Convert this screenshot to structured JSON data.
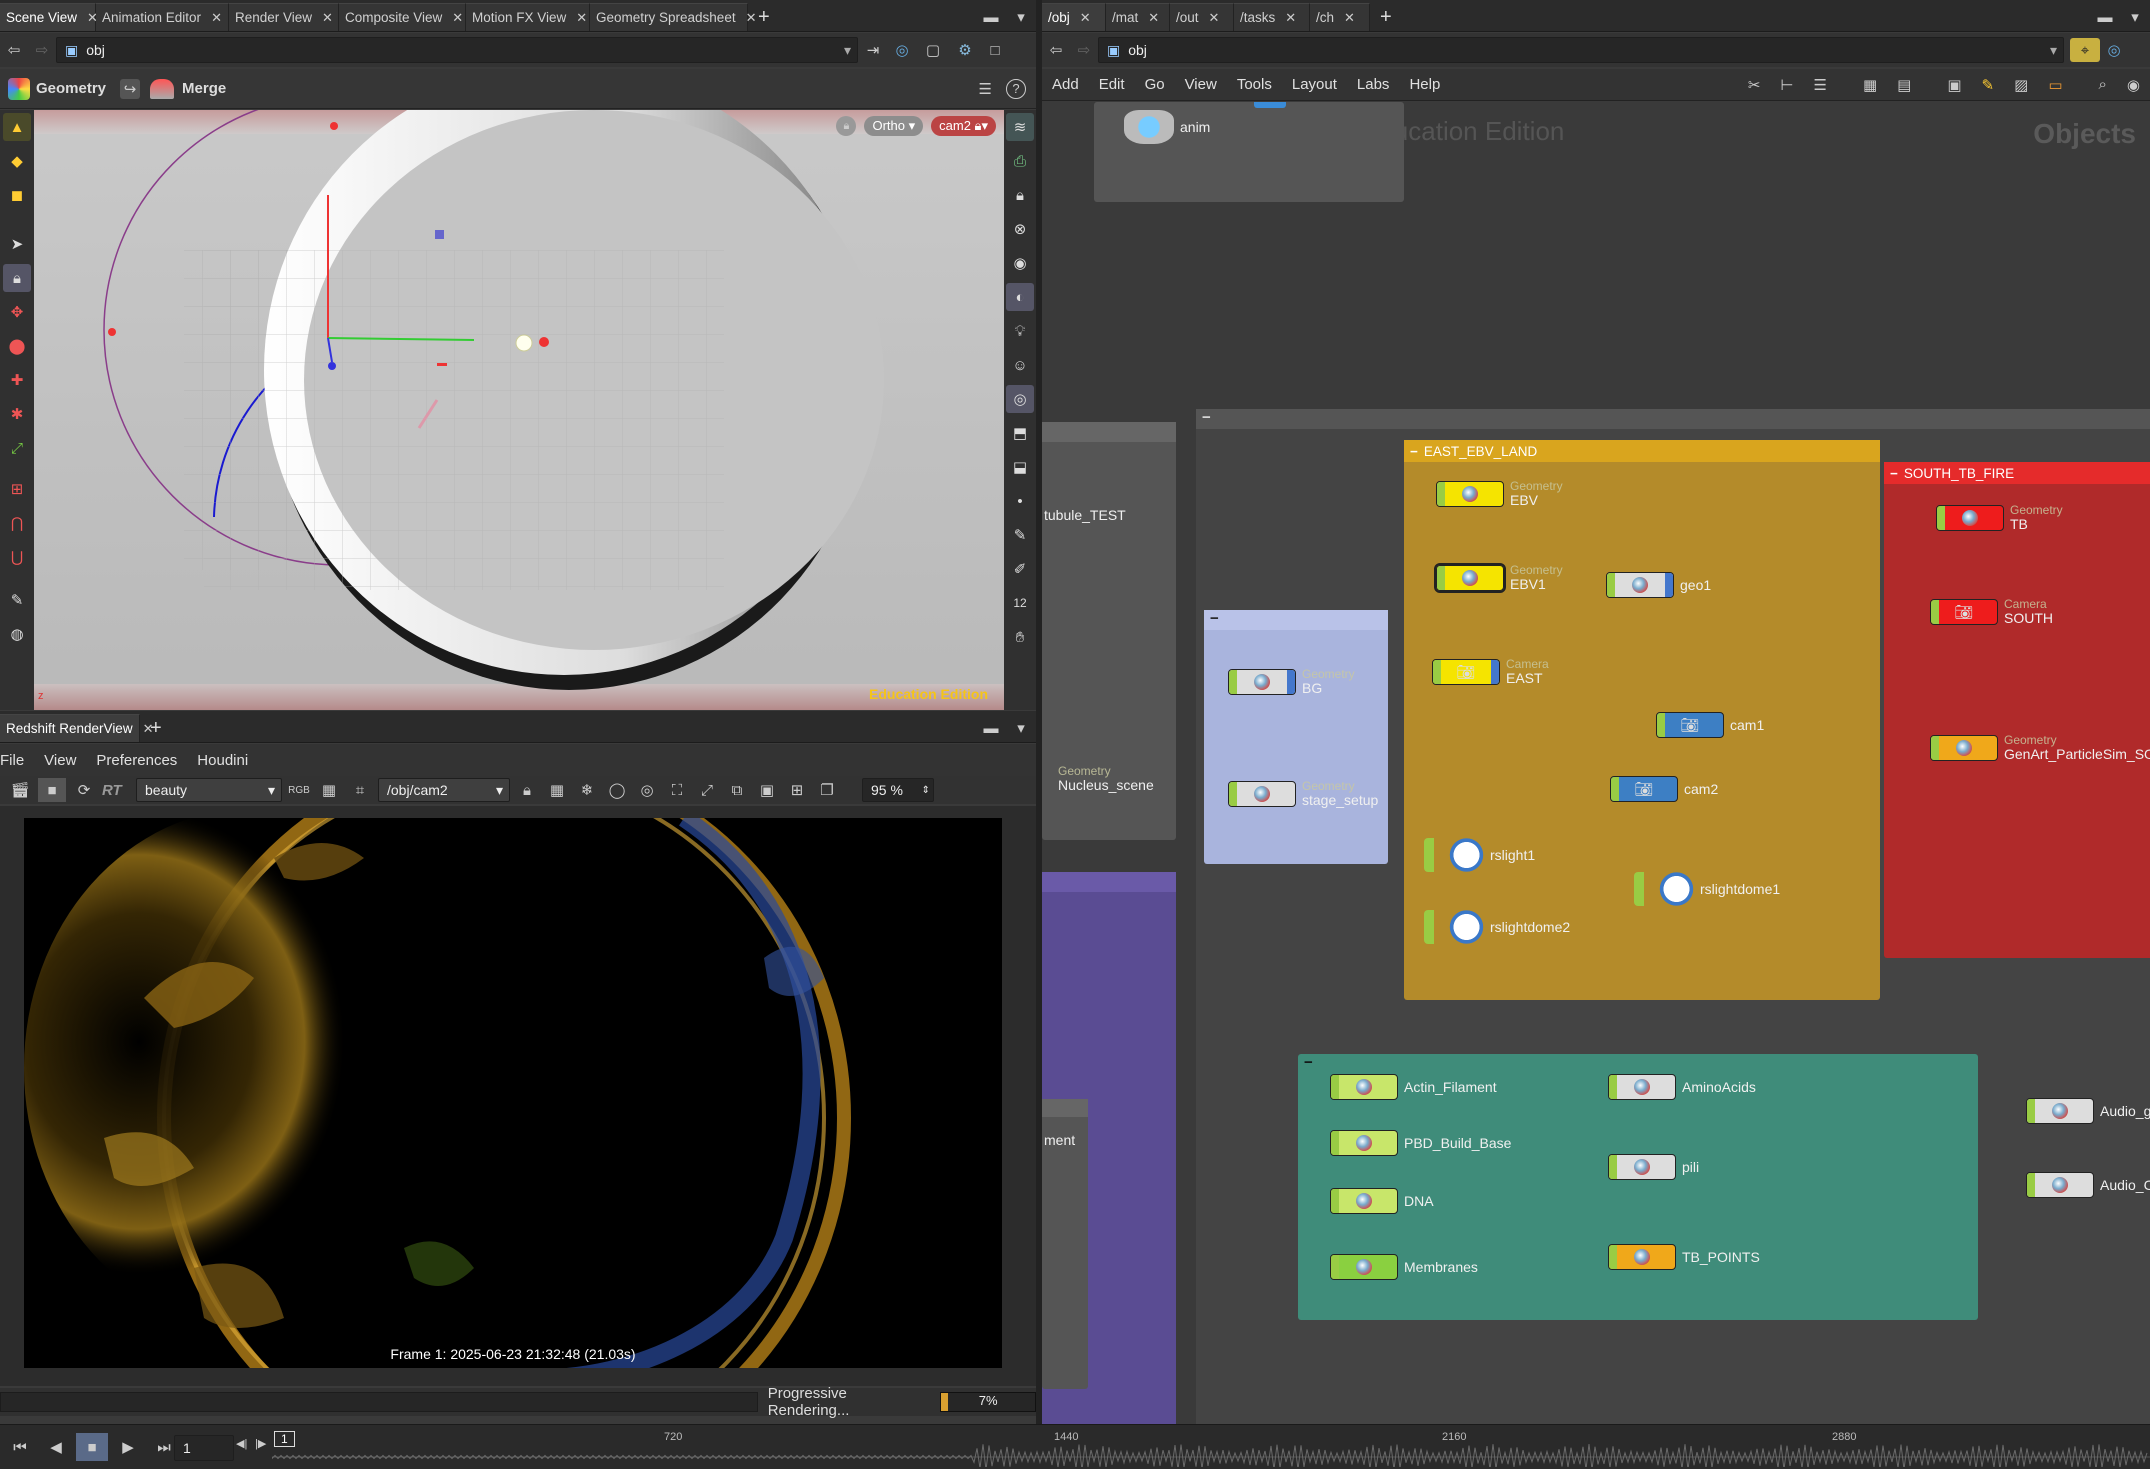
{
  "left_tabs": [
    {
      "label": "Scene View",
      "active": true
    },
    {
      "label": "Animation Editor"
    },
    {
      "label": "Render View"
    },
    {
      "label": "Composite View"
    },
    {
      "label": "Motion FX View"
    },
    {
      "label": "Geometry Spreadsheet"
    }
  ],
  "right_tabs": [
    {
      "label": "/obj",
      "active": true
    },
    {
      "label": "/mat"
    },
    {
      "label": "/out"
    },
    {
      "label": "/tasks"
    },
    {
      "label": "/ch"
    }
  ],
  "left_path": "obj",
  "right_path": "obj",
  "viewport": {
    "context1": "Geometry",
    "context2": "Merge",
    "projection": "Ortho",
    "camera": "cam2",
    "watermark": "Education Edition"
  },
  "network_menu": [
    "Add",
    "Edit",
    "Go",
    "View",
    "Tools",
    "Layout",
    "Labs",
    "Help"
  ],
  "network_watermark": "Education Edition",
  "network_title": "Objects",
  "render": {
    "tab": "Redshift RenderView",
    "menu": [
      "File",
      "View",
      "Preferences",
      "Houdini"
    ],
    "rt": "RT",
    "aov": "beauty",
    "camera": "/obj/cam2",
    "zoom": "95 %",
    "frame_info": "Frame 1: 2025-06-23 21:32:48 (21.03s)",
    "status": "Progressive Rendering...",
    "progress_label": "7%",
    "progress": 0.07
  },
  "network": {
    "anim_node": "anim",
    "partial_left_labels": [
      "tubule_TEST",
      "Nucleus_scene",
      "Geometry",
      "ment"
    ],
    "east_box": {
      "title": "EAST_EBV_LAND"
    },
    "south_box": {
      "title": "SOUTH_TB_FIRE"
    },
    "nodes": {
      "ebv": {
        "type": "Geometry",
        "name": "EBV"
      },
      "ebv1": {
        "type": "Geometry",
        "name": "EBV1"
      },
      "geo1": {
        "name": "geo1"
      },
      "east": {
        "type": "Camera",
        "name": "EAST"
      },
      "cam1": {
        "name": "cam1"
      },
      "cam2": {
        "name": "cam2"
      },
      "rslight1": {
        "name": "rslight1"
      },
      "rslightdome1": {
        "name": "rslightdome1"
      },
      "rslightdome2": {
        "name": "rslightdome2"
      },
      "bg": {
        "type": "Geometry",
        "name": "BG"
      },
      "stage": {
        "type": "Geometry",
        "name": "stage_setup"
      },
      "tb": {
        "type": "Geometry",
        "name": "TB"
      },
      "south": {
        "type": "Camera",
        "name": "SOUTH"
      },
      "genart": {
        "type": "Geometry",
        "name": "GenArt_ParticleSim_SO"
      },
      "actin": {
        "name": "Actin_Filament"
      },
      "pbd": {
        "name": "PBD_Build_Base"
      },
      "dna": {
        "name": "DNA"
      },
      "membranes": {
        "name": "Membranes"
      },
      "amino": {
        "name": "AminoAcids"
      },
      "pili": {
        "name": "pili"
      },
      "tbpoints": {
        "name": "TB_POINTS"
      },
      "audio1": {
        "name": "Audio_g"
      },
      "audio2": {
        "name": "Audio_C"
      }
    }
  },
  "timeline": {
    "frame": "1",
    "current": "1",
    "ticks": [
      "720",
      "1440",
      "2160",
      "2880"
    ]
  },
  "colors": {
    "east_box": "#d4a53a",
    "south_box": "#e52b2b",
    "blue_box": "#a9b4dd",
    "green_box": "#3f8c7a",
    "purple_box": "#5a4c93"
  }
}
